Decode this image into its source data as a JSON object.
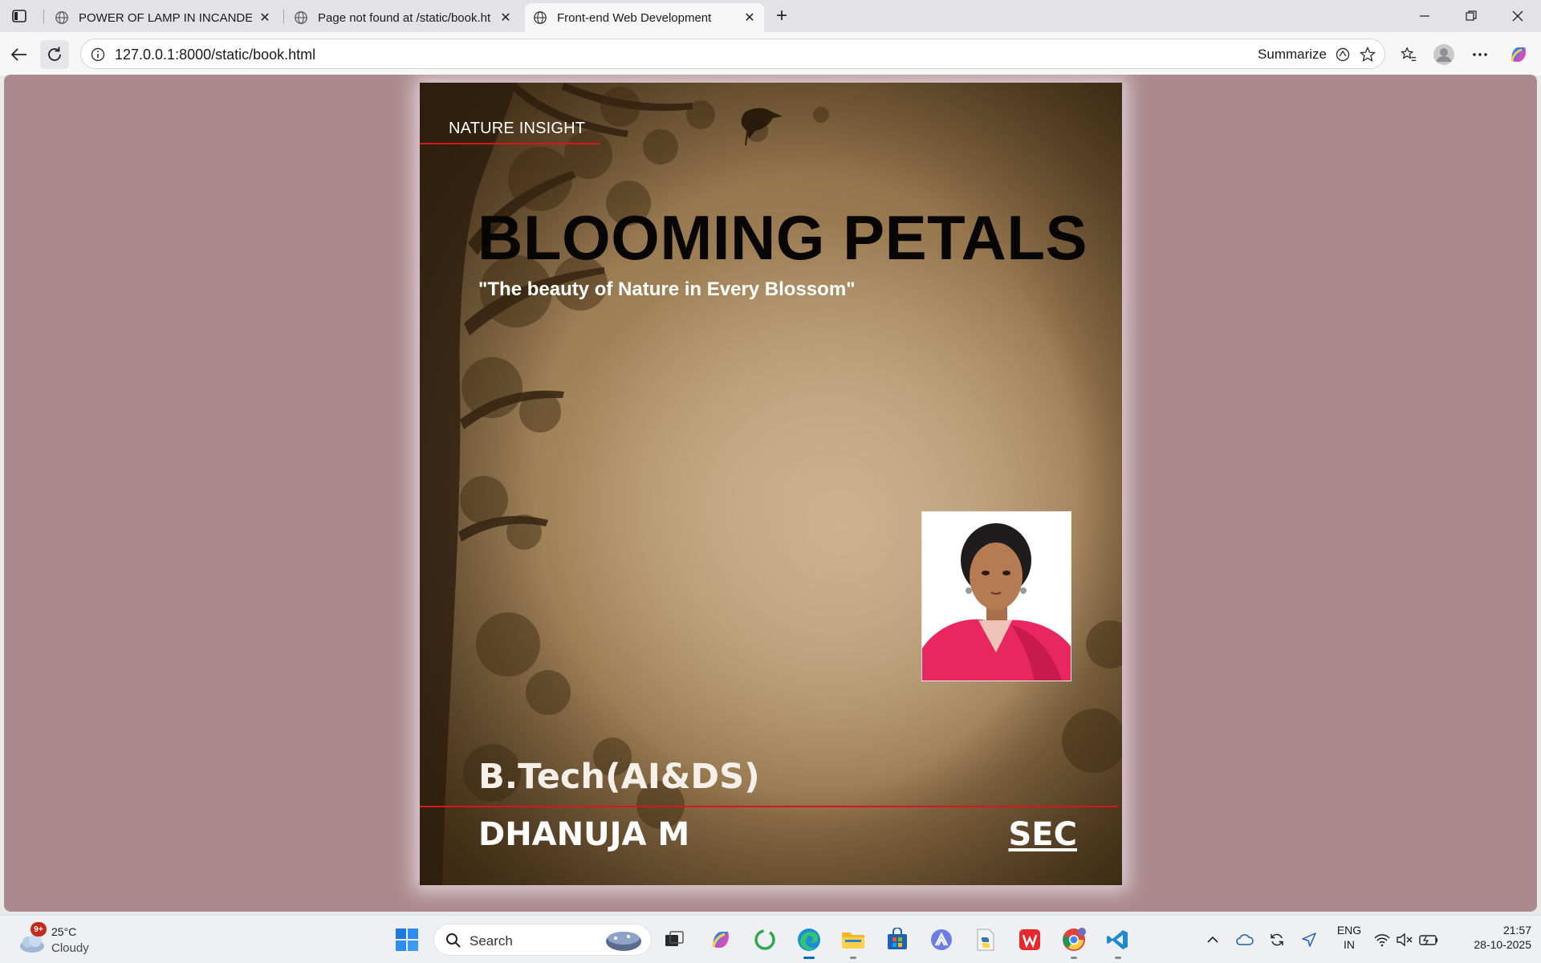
{
  "browser": {
    "tabs": [
      {
        "title": "POWER OF LAMP IN INCANDESC",
        "active": false
      },
      {
        "title": "Page not found at /static/book.ht",
        "active": false
      },
      {
        "title": "Front-end Web Development",
        "active": true
      }
    ],
    "address": "127.0.0.1:8000/static/book.html",
    "summarize_label": "Summarize"
  },
  "book": {
    "series": "NATURE INSIGHT",
    "title": "BLOOMING PETALS",
    "subtitle": "\"The beauty of Nature in Every Blossom\"",
    "degree": "B.Tech(AI&DS)",
    "author": "DHANUJA M",
    "college": "SEC"
  },
  "taskbar": {
    "weather_temp": "25°C",
    "weather_cond": "Cloudy",
    "weather_badge": "9+",
    "search_label": "Search",
    "lang_line1": "ENG",
    "lang_line2": "IN",
    "time": "21:57",
    "date": "28-10-2025"
  },
  "colors": {
    "page_background": "#ab8a8f",
    "accent_red": "#d4181c"
  }
}
